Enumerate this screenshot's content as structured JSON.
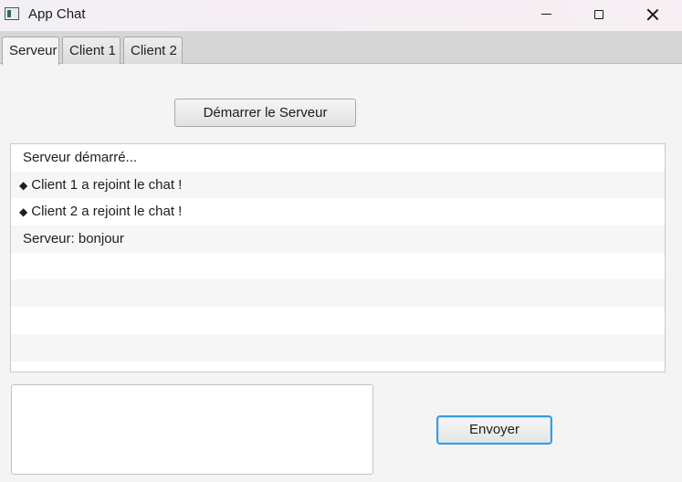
{
  "window": {
    "title": "App Chat",
    "controls": {
      "minimize_icon": "minimize-icon",
      "maximize_icon": "maximize-icon",
      "close_icon": "close-icon"
    }
  },
  "tabs": [
    {
      "label": "Serveur",
      "active": true
    },
    {
      "label": "Client 1",
      "active": false
    },
    {
      "label": "Client 2",
      "active": false
    }
  ],
  "server": {
    "start_button_label": "Démarrer le Serveur",
    "log": [
      {
        "icon": "",
        "text": "Serveur démarré..."
      },
      {
        "icon": "◆",
        "text": "Client 1 a rejoint le chat !"
      },
      {
        "icon": "◆",
        "text": "Client 2 a rejoint le chat !"
      },
      {
        "icon": "",
        "text": "Serveur: bonjour"
      },
      {
        "icon": "",
        "text": ""
      },
      {
        "icon": "",
        "text": ""
      },
      {
        "icon": "",
        "text": ""
      },
      {
        "icon": "",
        "text": ""
      }
    ],
    "message_input": {
      "value": "",
      "placeholder": ""
    },
    "send_button_label": "Envoyer"
  },
  "colors": {
    "focus_border": "#3a9be0",
    "background": "#f4f4f4",
    "tab_strip": "#d6d6d6"
  }
}
